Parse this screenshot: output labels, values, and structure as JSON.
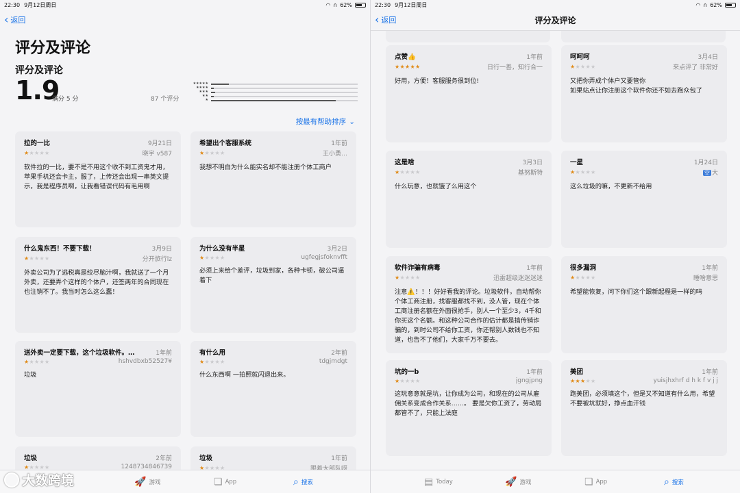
{
  "left": {
    "status": {
      "time": "22:30",
      "date": "9月12日周日",
      "battery": "62%"
    },
    "back_label": "返回",
    "big_title": "评分及评论",
    "section_title": "评分及评论",
    "average": "1.9",
    "average_sub": "满分 5 分",
    "count": "87 个评分",
    "sort_label": "按最有帮助排序",
    "histogram": [
      {
        "stars": "★★★★★",
        "fraction": 0.12
      },
      {
        "stars": "★★★★",
        "fraction": 0.02
      },
      {
        "stars": "★★★",
        "fraction": 0.03
      },
      {
        "stars": "★★",
        "fraction": 0.02
      },
      {
        "stars": "★",
        "fraction": 0.85
      }
    ],
    "reviews": [
      {
        "title": "拉的一比",
        "date": "9月21日",
        "rating": 1,
        "author": "晓宇 v587",
        "body": "软件拉的一比，要不是不用这个收不到工资鬼才用，苹果手机还会卡主，服了，上传还会出现一串英文提示，我是程序员啊，让我看错误代码有毛用啊"
      },
      {
        "title": "希望出个客服系统",
        "date": "1年前",
        "rating": 1,
        "author": "王小勇…",
        "body": "我想不明白为什么能实名却不能注册个体工商户"
      },
      {
        "title": "什么鬼东西！不要下载！",
        "date": "3月9日",
        "rating": 1,
        "author": "分开旅行lz",
        "body": "外卖公司为了逃税真是绞尽脑汁啊，我就送了一个月外卖，还要弄个这样的个体户，还签两年的合同现在也注销不了。我当时怎么这么蠢！"
      },
      {
        "title": "为什么没有半星",
        "date": "3月2日",
        "rating": 1,
        "author": "ugfegjsfoknvfft",
        "body": "必须上来给个差评，垃圾到家，各种卡顿，破公司逼着下"
      },
      {
        "title": "送外卖一定要下载，这个垃圾软件。不…",
        "date": "1年前",
        "rating": 1,
        "author": "hshvdbxb52527¥",
        "body": "垃圾"
      },
      {
        "title": "有什么用",
        "date": "2年前",
        "rating": 1,
        "author": "tdgjmdgt",
        "body": "什么东西啊 一拍照就闪退出来。"
      },
      {
        "title": "垃圾",
        "date": "2年前",
        "rating": 1,
        "author": "1248734846739",
        "body": ""
      },
      {
        "title": "垃圾",
        "date": "1年前",
        "rating": 1,
        "author": "跟着大部队呀",
        "body": ""
      }
    ],
    "tabs": [
      {
        "label": "游戏",
        "icon": "rocket-icon"
      },
      {
        "label": "App",
        "icon": "layers-icon"
      },
      {
        "label": "搜索",
        "icon": "search-icon"
      }
    ],
    "watermark": "大数跨境"
  },
  "right": {
    "status": {
      "time": "22:30",
      "date": "9月12日周日",
      "battery": "62%"
    },
    "back_label": "返回",
    "nav_title": "评分及评论",
    "reviews": [
      {
        "title": "点赞👍",
        "date": "1年前",
        "rating": 5,
        "author": "日行一善，知行合一",
        "body": "好用，方便！客服服务很到位!"
      },
      {
        "title": "呵呵呵",
        "date": "3月4日",
        "rating": 1,
        "author": "来点评了 非常好",
        "body": "又把你弄成个体户又要管你\n如果站点让你注册这个软件你还不如去跑众包了"
      },
      {
        "title": "这是啥",
        "date": "3月3日",
        "rating": 1,
        "author": "基努斯特",
        "body": "什么玩意，也就饿了么用这个"
      },
      {
        "title": "一星",
        "date": "1月24日",
        "rating": 1,
        "author": "大",
        "author_badge": "空",
        "body": "这么垃圾的嘛，不更新不给用"
      },
      {
        "title": "软件诈骗有病毒",
        "date": "1年前",
        "rating": 1,
        "author": "迅雷超级迷迷迷迷",
        "body": "注意⚠️！！！好好看我的评论。垃圾软件，自动帮你个体工商注册，找客服都找不到，没人管，现在个体工商注册名额在外面很抢手，别人一个至少3，4千和你买这个名额。和这种公司合作的估计都是搞传销诈骗的，到时公司不给你工资，你还帮别人数钱也不知道，也告不了他们，大家千万不要去。"
      },
      {
        "title": "很多漏洞",
        "date": "1年前",
        "rating": 1,
        "author": "睡啥意思",
        "body": "希望能恢复，问下你们这个跟新起程是一样的吗"
      },
      {
        "title": "坑的一b",
        "date": "1年前",
        "rating": 1,
        "author": "jgngjpng",
        "body": "这玩意意就是坑，让你成为公司，和现在的公司从雇佣关系变成合作关系……。   要是欠你工资了，劳动局都管不了，只能上法庭"
      },
      {
        "title": "美团",
        "date": "1年前",
        "rating": 3,
        "author": "yuisjhxhrf d h k f v j j",
        "body": "跑美团，必须填这个，但是又不知道有什么用，希望不要被坑就好，挣点血汗钱"
      }
    ],
    "tabs": [
      {
        "label": "Today",
        "icon": "today-icon"
      },
      {
        "label": "游戏",
        "icon": "rocket-icon"
      },
      {
        "label": "App",
        "icon": "layers-icon"
      },
      {
        "label": "搜索",
        "icon": "search-icon"
      }
    ]
  }
}
